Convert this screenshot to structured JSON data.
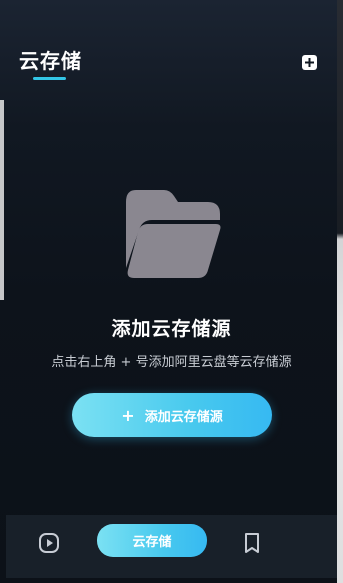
{
  "header": {
    "title": "云存储"
  },
  "empty_state": {
    "title": "添加云存储源",
    "subtitle": "点击右上角 + 号添加阿里云盘等云存储源",
    "button": {
      "plus": "+",
      "label": "添加云存储源"
    }
  },
  "bottom_nav": {
    "items": [
      {
        "icon": "play-square-icon"
      },
      {
        "label": "云存储"
      },
      {
        "icon": "bookmark-icon"
      }
    ]
  },
  "colors": {
    "accent": "#36b9f2",
    "accent_light": "#7be1f3",
    "underline": "#33c6e6",
    "folder": "#8a8790"
  }
}
